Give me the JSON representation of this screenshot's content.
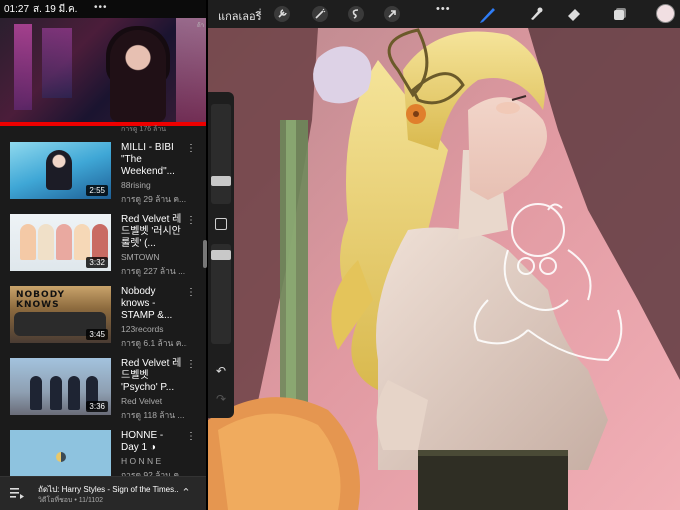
{
  "status_bar": {
    "time": "01:27",
    "date": "ส. 19 มี.ค.",
    "more": "•••"
  },
  "mini_player": {
    "corner_hint": "ถ้า"
  },
  "partial_row_text": "การดู 176 ล้าน",
  "videos": [
    {
      "title": "MILLI - BIBI \"The Weekend\"...",
      "channel": "88rising",
      "views": "การดู 29 ล้าน ค...",
      "duration": "2:55"
    },
    {
      "title": "Red Velvet 레드벨벳 '러시안 룰렛' (...",
      "channel": "SMTOWN",
      "views": "การดู 227 ล้าน ...",
      "duration": "3:32"
    },
    {
      "title": "Nobody knows - STAMP &...",
      "channel": "123records",
      "views": "การดู 6.1 ล้าน ค...",
      "duration": "3:45",
      "thumb_text": "NOBODY KNOWS"
    },
    {
      "title": "Red Velvet 레드벨벳 'Psycho' P...",
      "channel": "Red Velvet",
      "views": "การดู 118 ล้าน ...",
      "duration": "3:36"
    },
    {
      "title": "HONNE - Day 1 ◑",
      "channel": "H O N N E",
      "views": "การดู 92 ล้าน ค...",
      "duration": ""
    }
  ],
  "up_next": {
    "text": "ถัดไป: Harry Styles - Sign of the Times...",
    "sub": "วิดีโอที่ชอบ • 11/1102"
  },
  "drawing_app": {
    "gallery_label": "แกลเลอรี่",
    "more": "•••",
    "accent_color": "#2f7df6",
    "current_color": "#f1dfe2"
  },
  "icons": {
    "toolbar": [
      "wrench-icon",
      "magic-wand-icon",
      "selection-icon",
      "transform-arrow-icon",
      "brush-icon",
      "smudge-icon",
      "eraser-icon",
      "layers-icon"
    ],
    "sidebar": [
      "undo-icon",
      "redo-icon",
      "modify-square-icon"
    ],
    "bottom": [
      "queue-icon",
      "chevron-up-icon"
    ]
  }
}
